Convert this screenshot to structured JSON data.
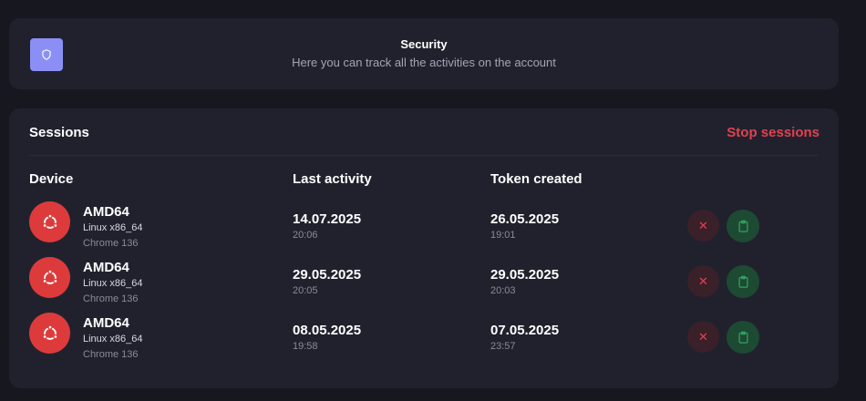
{
  "header": {
    "icon": "shield-icon",
    "title": "Security",
    "subtitle": "Here you can track all the activities on the account"
  },
  "sessions": {
    "title": "Sessions",
    "stop_label": "Stop sessions",
    "columns": {
      "device": "Device",
      "last_activity": "Last activity",
      "token_created": "Token created"
    },
    "rows": [
      {
        "icon": "ubuntu-icon",
        "device": "AMD64",
        "os": "Linux x86_64",
        "browser": "Chrome 136",
        "last_activity_date": "14.07.2025",
        "last_activity_time": "20:06",
        "token_date": "26.05.2025",
        "token_time": "19:01"
      },
      {
        "icon": "ubuntu-icon",
        "device": "AMD64",
        "os": "Linux x86_64",
        "browser": "Chrome 136",
        "last_activity_date": "29.05.2025",
        "last_activity_time": "20:05",
        "token_date": "29.05.2025",
        "token_time": "20:03"
      },
      {
        "icon": "ubuntu-icon",
        "device": "AMD64",
        "os": "Linux x86_64",
        "browser": "Chrome 136",
        "last_activity_date": "08.05.2025",
        "last_activity_time": "19:58",
        "token_date": "07.05.2025",
        "token_time": "23:57"
      }
    ]
  },
  "colors": {
    "background": "#17171f",
    "card": "#21212e",
    "accent_purple": "#8b8ff5",
    "danger": "#e0424f",
    "success": "#2fa35f",
    "avatar_red": "#dd3b3b"
  }
}
